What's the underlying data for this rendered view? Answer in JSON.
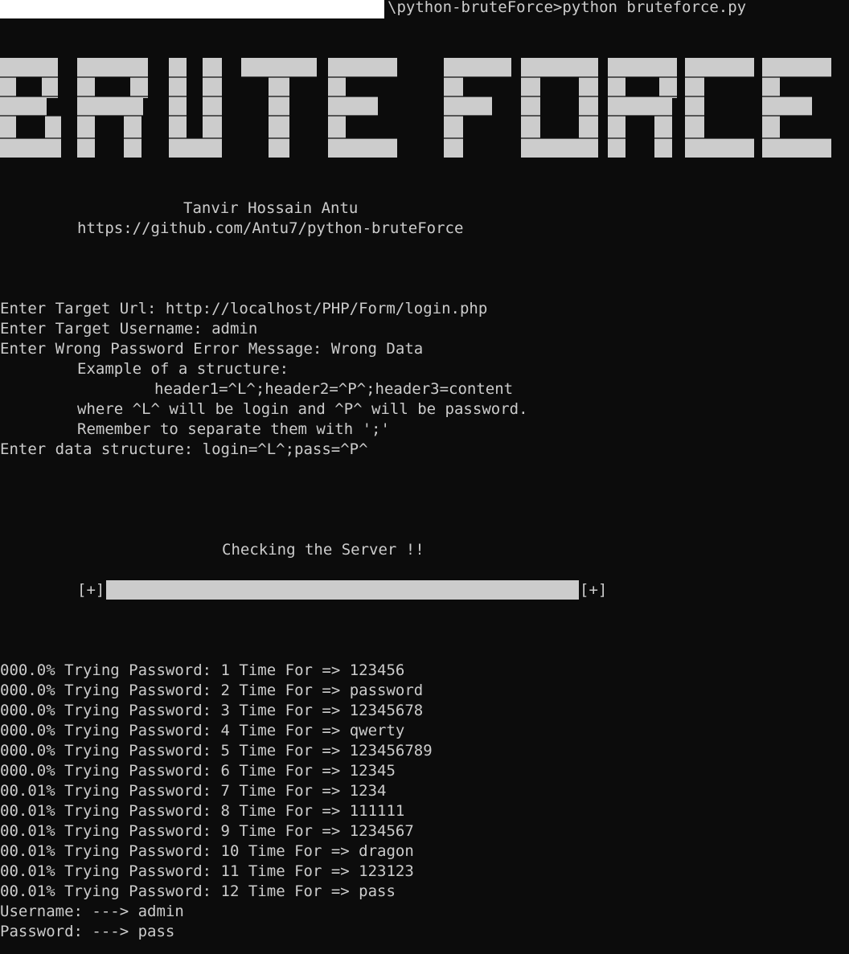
{
  "window": {
    "prompt_path": "\\python-bruteForce>",
    "command": "python bruteforce.py"
  },
  "banner": {
    "text": "BRUTE FORCE",
    "color": "#cccccc"
  },
  "credits": {
    "author": "Tanvir Hossain Antu",
    "repo": "https://github.com/Antu7/python-bruteForce"
  },
  "inputs": {
    "url_line": "Enter Target Url: http://localhost/PHP/Form/login.php",
    "username_line": "Enter Target Username: admin",
    "error_line": "Enter Wrong Password Error Message: Wrong Data",
    "example_heading": "Example of a structure:",
    "example_value": "header1=^L^;header2=^P^;header3=content",
    "example_where": "where ^L^ will be login and ^P^ will be password.",
    "example_remember": "Remember to separate them with ';'",
    "structure_line": "Enter data structure: login=^L^;pass=^P^"
  },
  "server_check": {
    "label": "Checking the Server !!",
    "left_marker": "[+]",
    "right_marker": "[+]",
    "progress": 1.0
  },
  "attempts": [
    {
      "percent": "000.0%",
      "text": "Trying Password: 1 Time For => 123456"
    },
    {
      "percent": "000.0%",
      "text": "Trying Password: 2 Time For => password"
    },
    {
      "percent": "000.0%",
      "text": "Trying Password: 3 Time For => 12345678"
    },
    {
      "percent": "000.0%",
      "text": "Trying Password: 4 Time For => qwerty"
    },
    {
      "percent": "000.0%",
      "text": "Trying Password: 5 Time For => 123456789"
    },
    {
      "percent": "000.0%",
      "text": "Trying Password: 6 Time For => 12345"
    },
    {
      "percent": "00.01%",
      "text": "Trying Password: 7 Time For => 1234"
    },
    {
      "percent": "00.01%",
      "text": "Trying Password: 8 Time For => 111111"
    },
    {
      "percent": "00.01%",
      "text": "Trying Password: 9 Time For => 1234567"
    },
    {
      "percent": "00.01%",
      "text": "Trying Password: 10 Time For => dragon"
    },
    {
      "percent": "00.01%",
      "text": "Trying Password: 11 Time For => 123123"
    },
    {
      "percent": "00.01%",
      "text": "Trying Password: 12 Time For => pass"
    }
  ],
  "result": {
    "username_line": "Username: ---> admin",
    "password_line": "Password: ---> pass"
  },
  "colors": {
    "background": "#0c0c0c",
    "foreground": "#cccccc",
    "redaction": "#ffffff"
  }
}
